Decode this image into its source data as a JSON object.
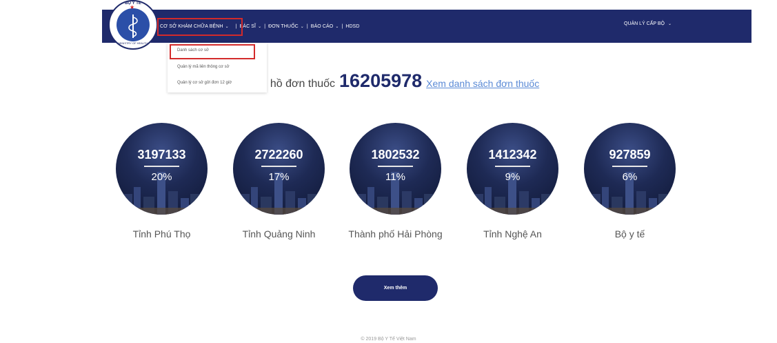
{
  "logo": {
    "top_text": "BỘ Y TẾ",
    "bottom_text": "MINISTRY OF HEALTH"
  },
  "nav": {
    "items": [
      {
        "label": "CƠ SỞ KHÁM CHỮA BỆNH"
      },
      {
        "label": "BÁC SĨ"
      },
      {
        "label": "ĐƠN THUỐC"
      },
      {
        "label": "BÁO CÁO"
      },
      {
        "label": "HDSD"
      }
    ],
    "separator": "|",
    "right_label": "QUẢN LÝ CẤP BỘ"
  },
  "dropdown": {
    "items": [
      {
        "label": "Danh sách cơ sở"
      },
      {
        "label": "Quản lý mã liên thông cơ sở"
      },
      {
        "label": "Quản lý cơ sở gửi đơn 12 giờ"
      }
    ]
  },
  "headline": {
    "prefix": "; hồ đơn thuốc",
    "total": "16205978",
    "link": "Xem danh sách đơn thuốc"
  },
  "stats": [
    {
      "value": "3197133",
      "percent": "20%",
      "label": "Tỉnh Phú Thọ"
    },
    {
      "value": "2722260",
      "percent": "17%",
      "label": "Tỉnh Quảng Ninh"
    },
    {
      "value": "1802532",
      "percent": "11%",
      "label": "Thành phố Hải Phòng"
    },
    {
      "value": "1412342",
      "percent": "9%",
      "label": "Tỉnh Nghệ An"
    },
    {
      "value": "927859",
      "percent": "6%",
      "label": "Bộ y tế"
    }
  ],
  "more_button": "Xem thêm",
  "footer": "© 2019 Bộ Y Tế Việt Nam",
  "colors": {
    "navbar": "#1f2a6b",
    "highlight": "#d32a2a",
    "link": "#5a8ad6"
  }
}
